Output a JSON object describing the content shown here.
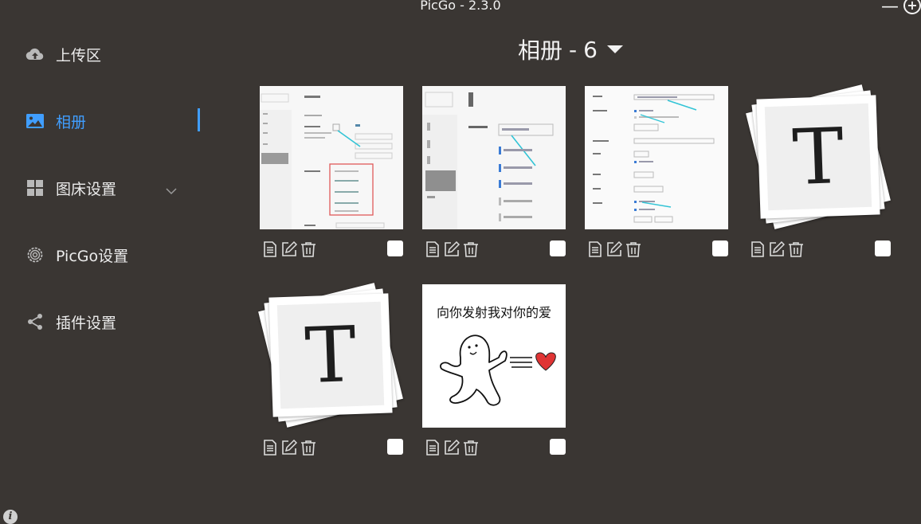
{
  "window": {
    "title": "PicGo - 2.3.0",
    "minimize_icon": "minimize-icon",
    "maximize_icon": "maximize-icon"
  },
  "sidebar": {
    "items": [
      {
        "label": "上传区",
        "icon": "cloud-upload-icon"
      },
      {
        "label": "相册",
        "icon": "image-icon",
        "active": true
      },
      {
        "label": "图床设置",
        "icon": "grid-icon",
        "has_submenu": true
      },
      {
        "label": "PicGo设置",
        "icon": "gear-icon"
      },
      {
        "label": "插件设置",
        "icon": "share-icon"
      }
    ],
    "accent": "#409eff"
  },
  "album": {
    "title": "相册",
    "separator": "-",
    "count": "6",
    "caret_icon": "caret-down-icon"
  },
  "gallery": {
    "items": [
      {
        "kind": "screenshot",
        "checked": false
      },
      {
        "kind": "screenshot",
        "checked": false
      },
      {
        "kind": "screenshot",
        "checked": false
      },
      {
        "kind": "typora-logo",
        "letter": "T",
        "checked": false
      },
      {
        "kind": "typora-logo",
        "letter": "T",
        "checked": false
      },
      {
        "kind": "meme",
        "caption": "向你发射我对你的爱",
        "checked": false
      }
    ],
    "action_icons": [
      "copy-link-icon",
      "edit-icon",
      "delete-icon"
    ]
  }
}
